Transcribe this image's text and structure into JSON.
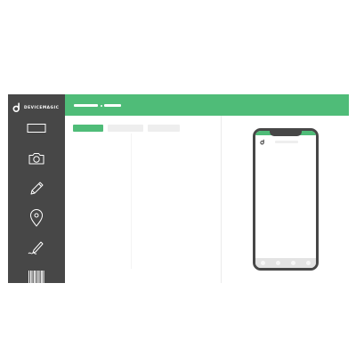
{
  "app": {
    "brand": "DEVICEMAGIC",
    "accent_color": "#4fbc78",
    "sidebar_color": "#474747"
  },
  "sidebar": {
    "tools": [
      {
        "icon": "text-field-icon"
      },
      {
        "icon": "camera-icon"
      },
      {
        "icon": "pencil-icon"
      },
      {
        "icon": "location-pin-icon"
      },
      {
        "icon": "signature-pen-icon"
      },
      {
        "icon": "barcode-icon"
      }
    ]
  },
  "phone_preview": {
    "icon": "logo-icon"
  }
}
